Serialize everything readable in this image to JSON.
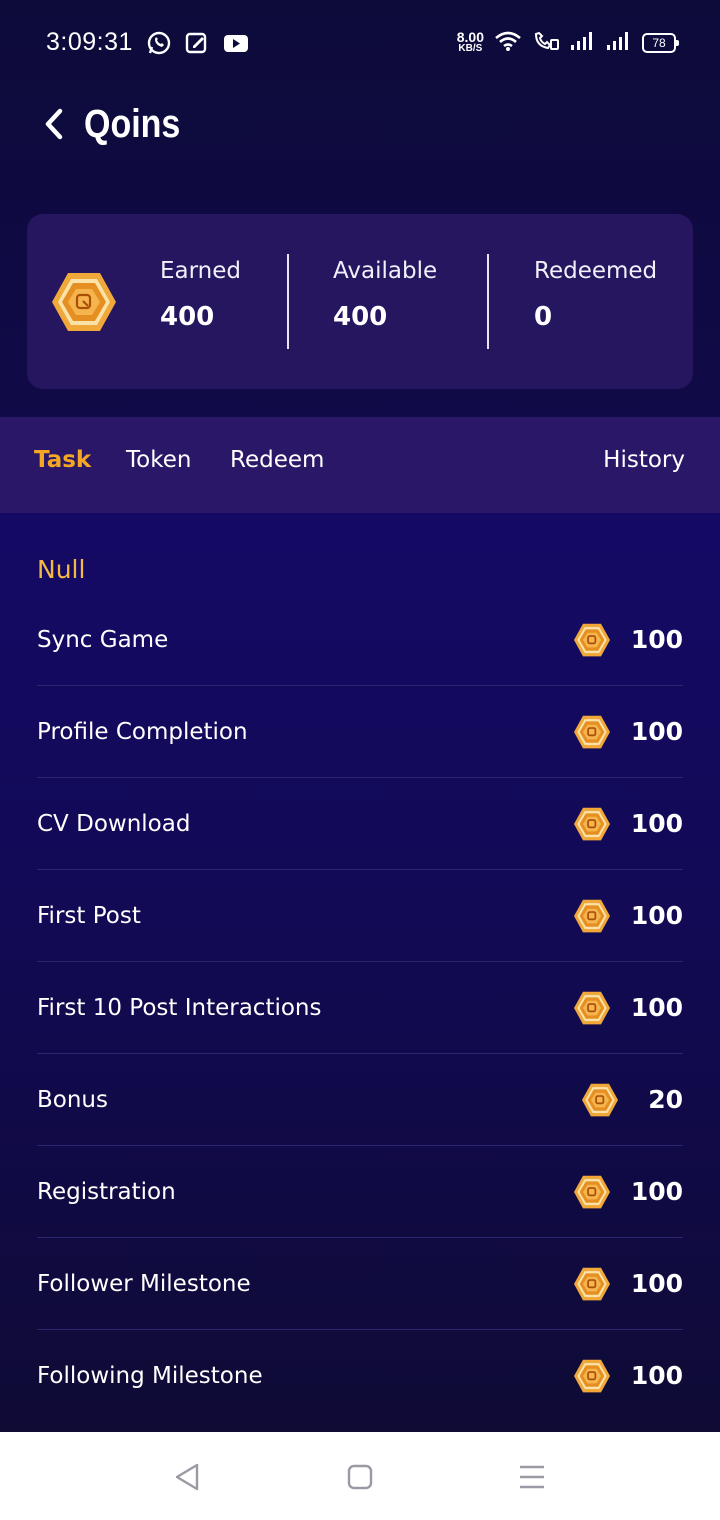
{
  "status_bar": {
    "time": "3:09:31",
    "network_speed_value": "8.00",
    "network_speed_unit": "KB/S",
    "battery": "78",
    "left_icons": [
      "whatsapp-icon",
      "edit-note-icon",
      "youtube-icon"
    ],
    "right_icons": [
      "wifi-icon",
      "wifi-call-icon",
      "signal-icon",
      "signal-icon"
    ]
  },
  "header": {
    "title": "Qoins"
  },
  "summary": {
    "earned_label": "Earned",
    "earned_value": "400",
    "available_label": "Available",
    "available_value": "400",
    "redeemed_label": "Redeemed",
    "redeemed_value": "0"
  },
  "tabs": [
    {
      "label": "Task",
      "active": true
    },
    {
      "label": "Token",
      "active": false
    },
    {
      "label": "Redeem",
      "active": false
    },
    {
      "label": "History",
      "active": false
    }
  ],
  "section_title": "Null",
  "tasks": [
    {
      "label": "Sync Game",
      "amount": "100"
    },
    {
      "label": "Profile Completion",
      "amount": "100"
    },
    {
      "label": "CV Download",
      "amount": "100"
    },
    {
      "label": "First Post",
      "amount": "100"
    },
    {
      "label": "First 10 Post Interactions",
      "amount": "100"
    },
    {
      "label": "Bonus",
      "amount": "20"
    },
    {
      "label": "Registration",
      "amount": "100"
    },
    {
      "label": "Follower Milestone",
      "amount": "100"
    },
    {
      "label": "Following Milestone",
      "amount": "100"
    }
  ],
  "colors": {
    "accent": "#f5a623",
    "card": "#261660",
    "tab_bar": "#2a1768",
    "coin": "#e8a33a"
  }
}
